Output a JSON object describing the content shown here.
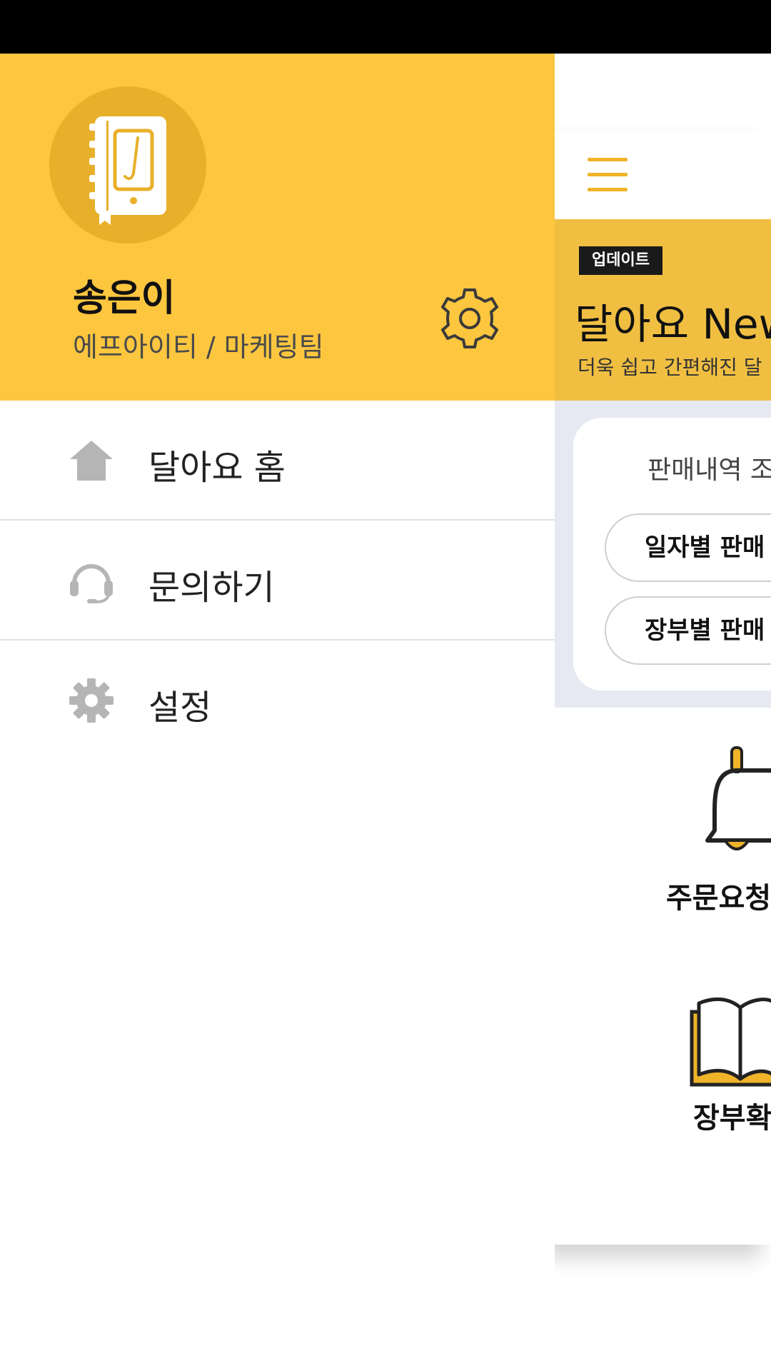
{
  "drawer": {
    "user": {
      "name": "송은이",
      "org": "에프아이티 / 마케팅팀"
    },
    "colors": {
      "header_bg": "#fcc63f",
      "avatar_bg": "#e8b02a",
      "menu_icon": "#b5b5b5"
    },
    "menu": [
      {
        "label": "달아요 홈",
        "icon": "home-icon"
      },
      {
        "label": "문의하기",
        "icon": "headset-icon"
      },
      {
        "label": "설정",
        "icon": "gear-icon"
      }
    ]
  },
  "main": {
    "banner": {
      "badge": "업데이트",
      "title": "달아요 New",
      "subtitle": "더욱 쉽고 간편해진 달"
    },
    "sales": {
      "title": "판매내역 조",
      "buttons": [
        "일자별 판매",
        "장부별 판매"
      ]
    },
    "features": [
      {
        "label": "주문요청",
        "icon": "bell-icon"
      },
      {
        "label": "장부확",
        "icon": "book-icon"
      }
    ]
  }
}
